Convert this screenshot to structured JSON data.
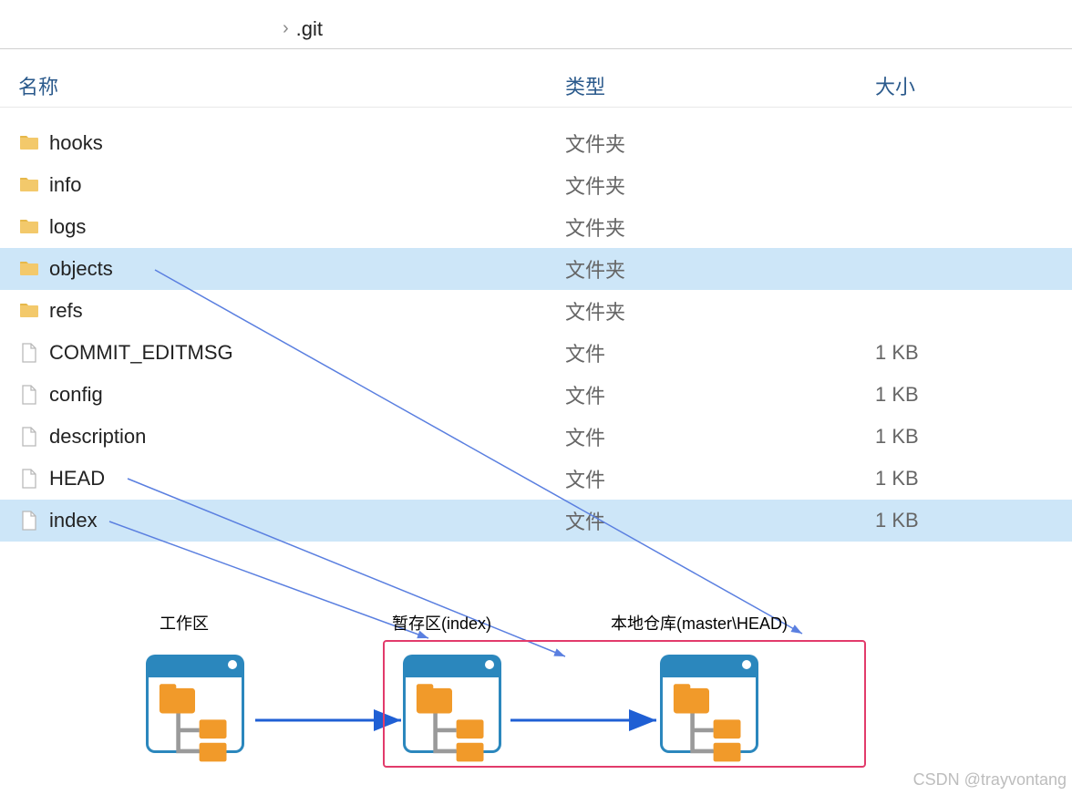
{
  "breadcrumb": {
    "current": ".git"
  },
  "columns": {
    "name": "名称",
    "type": "类型",
    "size": "大小"
  },
  "rows": [
    {
      "name": "hooks",
      "type": "文件夹",
      "size": "",
      "icon": "folder",
      "selected": false
    },
    {
      "name": "info",
      "type": "文件夹",
      "size": "",
      "icon": "folder",
      "selected": false
    },
    {
      "name": "logs",
      "type": "文件夹",
      "size": "",
      "icon": "folder",
      "selected": false
    },
    {
      "name": "objects",
      "type": "文件夹",
      "size": "",
      "icon": "folder",
      "selected": true
    },
    {
      "name": "refs",
      "type": "文件夹",
      "size": "",
      "icon": "folder",
      "selected": false
    },
    {
      "name": "COMMIT_EDITMSG",
      "type": "文件",
      "size": "1 KB",
      "icon": "file",
      "selected": false
    },
    {
      "name": "config",
      "type": "文件",
      "size": "1 KB",
      "icon": "file",
      "selected": false
    },
    {
      "name": "description",
      "type": "文件",
      "size": "1 KB",
      "icon": "file",
      "selected": false
    },
    {
      "name": "HEAD",
      "type": "文件",
      "size": "1 KB",
      "icon": "file",
      "selected": false
    },
    {
      "name": "index",
      "type": "文件",
      "size": "1 KB",
      "icon": "file",
      "selected": true
    }
  ],
  "diagram": {
    "labels": {
      "work": "工作区",
      "stage": "暂存区(index)",
      "repo": "本地仓库(master\\HEAD)"
    }
  },
  "watermark": "CSDN @trayvontang"
}
